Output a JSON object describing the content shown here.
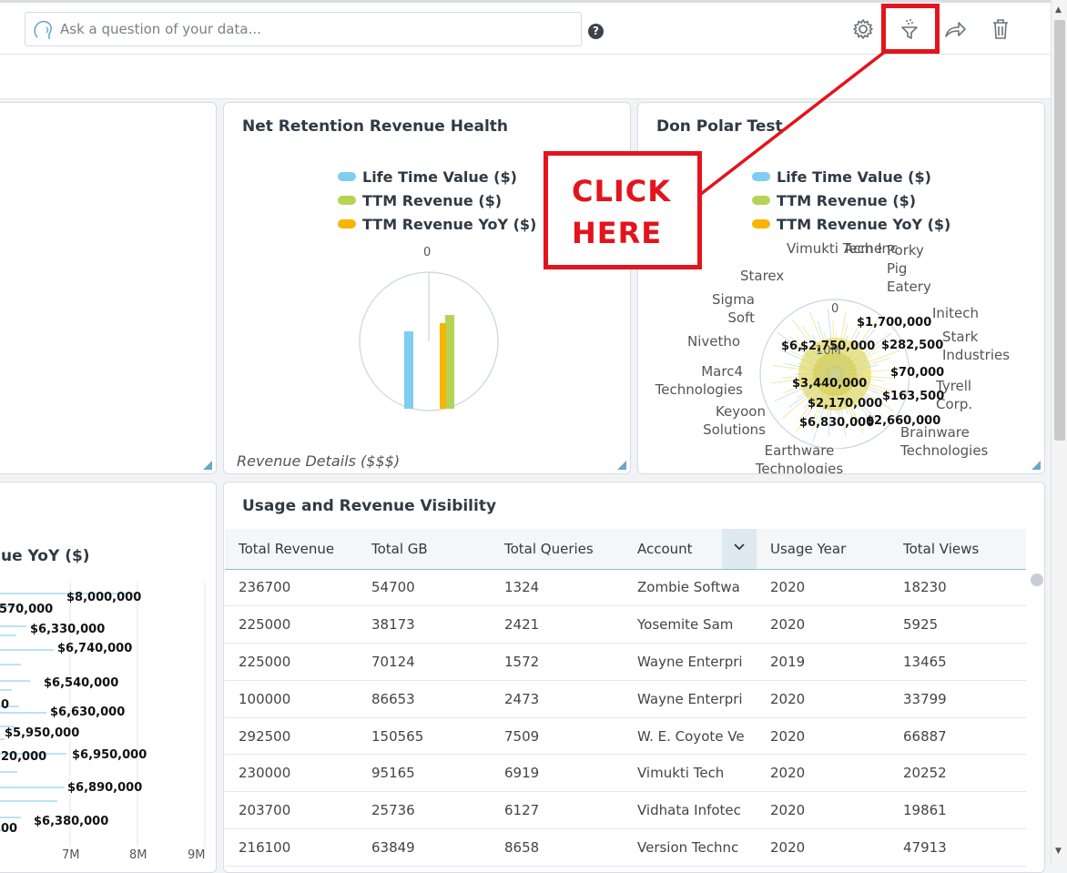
{
  "toolbar": {
    "search_placeholder": "Ask a question of your data...",
    "help_label": "?"
  },
  "callout": {
    "line1": "CLICK",
    "line2": "HERE"
  },
  "colors": {
    "ltv": "#7fcdf0",
    "ttm": "#b4d456",
    "yoy": "#f7b500",
    "callout": "#e3141c"
  },
  "panel_nrrh": {
    "title": "Net Retention Revenue Health",
    "legend": [
      "Life Time Value ($)",
      "TTM Revenue ($)",
      "TTM Revenue YoY ($)"
    ],
    "zero_label": "0",
    "footnote": "Revenue Details ($$$)"
  },
  "panel_dpt": {
    "title": "Don Polar Test",
    "legend": [
      "Life Time Value ($)",
      "TTM Revenue ($)",
      "TTM Revenue YoY ($)"
    ],
    "zero_label": "0",
    "ring_label": "10M",
    "accounts": [
      "Vimukti Tech Inc",
      "Acme",
      "Porky Pig Eatery",
      "Initech",
      "Stark Industries",
      "Tyrell Corp.",
      "Brainware Technologies",
      "Earthware Technologies",
      "Keyoon Solutions",
      "Marc4 Technologies",
      "Nivetho",
      "Sigma Soft",
      "Starex"
    ],
    "value_labels": [
      "$1,700,000",
      "$6,",
      "$2,750,000",
      "$282,500",
      "$70,000",
      "$3,440,000",
      "$163,500",
      "$2,170,000",
      "$6,830,000",
      "$2,660,000"
    ]
  },
  "panel_left_bottom": {
    "title_fragment": "ue YoY ($)",
    "x_ticks": [
      "7M",
      "8M",
      "9M"
    ],
    "value_labels": [
      "$8,000,000",
      "570,000",
      "$6,330,000",
      "$6,740,000",
      "$6,540,000",
      "0",
      "$6,630,000",
      "$5,950,000",
      "20,000",
      "$6,950,000",
      "$6,890,000",
      "$6,380,000",
      "00"
    ]
  },
  "table": {
    "title": "Usage and Revenue Visibility",
    "columns": [
      "Total Revenue",
      "Total GB",
      "Total Queries",
      "Account",
      "Usage Year",
      "Total Views"
    ],
    "rows": [
      [
        "236700",
        "54700",
        "1324",
        "Zombie Softwa",
        "2020",
        "18230"
      ],
      [
        "225000",
        "38173",
        "2421",
        "Yosemite Sam",
        "2020",
        "5925"
      ],
      [
        "225000",
        "70124",
        "1572",
        "Wayne Enterpri",
        "2019",
        "13465"
      ],
      [
        "100000",
        "86653",
        "2473",
        "Wayne Enterpri",
        "2020",
        "33799"
      ],
      [
        "292500",
        "150565",
        "7509",
        "W. E. Coyote Ve",
        "2020",
        "66887"
      ],
      [
        "230000",
        "95165",
        "6919",
        "Vimukti Tech",
        "2020",
        "20252"
      ],
      [
        "203700",
        "25736",
        "6127",
        "Vidhata Infotec",
        "2020",
        "19861"
      ],
      [
        "216100",
        "63849",
        "8658",
        "Version Technc",
        "2020",
        "47913"
      ]
    ]
  }
}
